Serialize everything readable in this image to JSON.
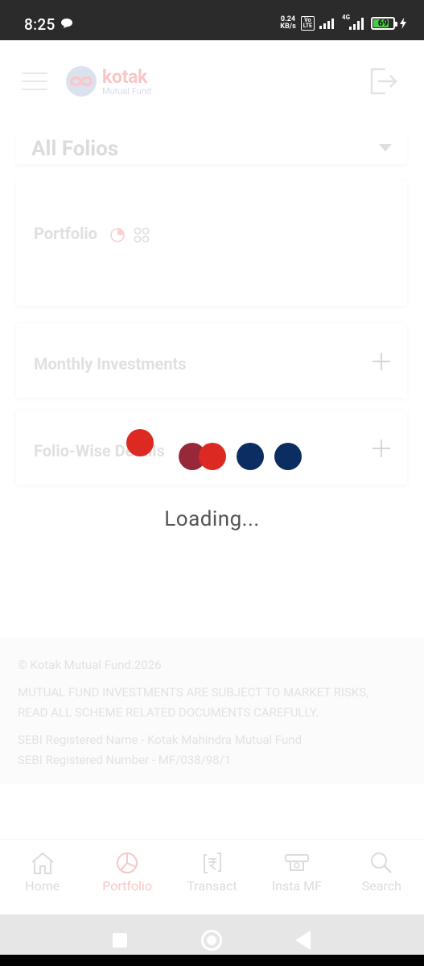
{
  "status_bar": {
    "time": "8:25",
    "net_speed_value": "0.24",
    "net_speed_unit": "KB/s",
    "volte_top": "Vo",
    "volte_bottom": "LTE",
    "network": "4G",
    "battery": "69"
  },
  "header": {
    "brand": "kotak",
    "brand_sub": "Mutual Fund"
  },
  "folio_selector": {
    "selected": "All Folios"
  },
  "cards": {
    "portfolio": "Portfolio",
    "monthly": "Monthly Investments",
    "foliowise": "Folio-Wise Details"
  },
  "loader": {
    "text": "Loading...",
    "colors": {
      "red": "#dc2a22",
      "dark_red": "#96283a",
      "navy": "#0c2d61"
    }
  },
  "footer": {
    "copyright": "© Kotak Mutual Fund.2026",
    "disclaimer_line1": "MUTUAL FUND INVESTMENTS ARE SUBJECT TO MARKET RISKS,",
    "disclaimer_line2": "READ ALL SCHEME RELATED DOCUMENTS CAREFULLY.",
    "sebi_name": "SEBI Registered Name - Kotak Mahindra Mutual Fund",
    "sebi_number": "SEBI Registered Number - MF/038/98/1"
  },
  "bottom_nav": {
    "items": [
      {
        "label": "Home",
        "icon": "home-icon",
        "active": false
      },
      {
        "label": "Portfolio",
        "icon": "pie-chart-icon",
        "active": true
      },
      {
        "label": "Transact",
        "icon": "rupee-exchange-icon",
        "active": false
      },
      {
        "label": "Insta MF",
        "icon": "atm-icon",
        "active": false
      },
      {
        "label": "Search",
        "icon": "search-icon",
        "active": false
      }
    ]
  }
}
